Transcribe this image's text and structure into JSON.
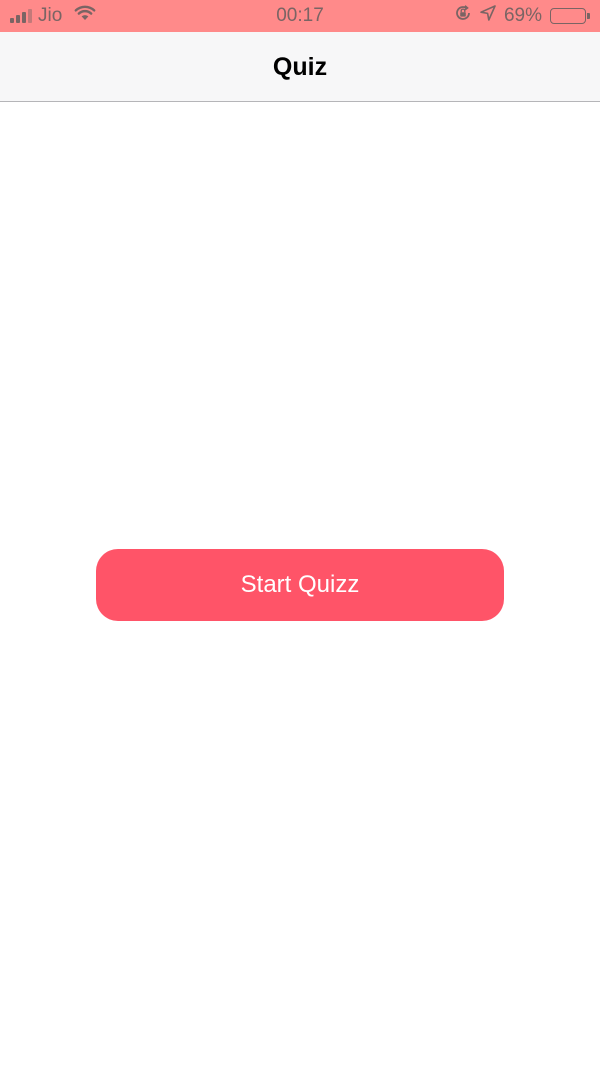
{
  "status_bar": {
    "carrier": "Jio",
    "time": "00:17",
    "battery_percent": "69%",
    "battery_level": 0.69,
    "icons": [
      "signal-icon",
      "wifi-icon",
      "rotation-lock-icon",
      "location-icon",
      "battery-icon"
    ],
    "background_color": "#ff8a8a"
  },
  "nav_bar": {
    "title": "Quiz"
  },
  "main": {
    "start_button_label": "Start Quizz",
    "button_color": "#ff5468"
  }
}
